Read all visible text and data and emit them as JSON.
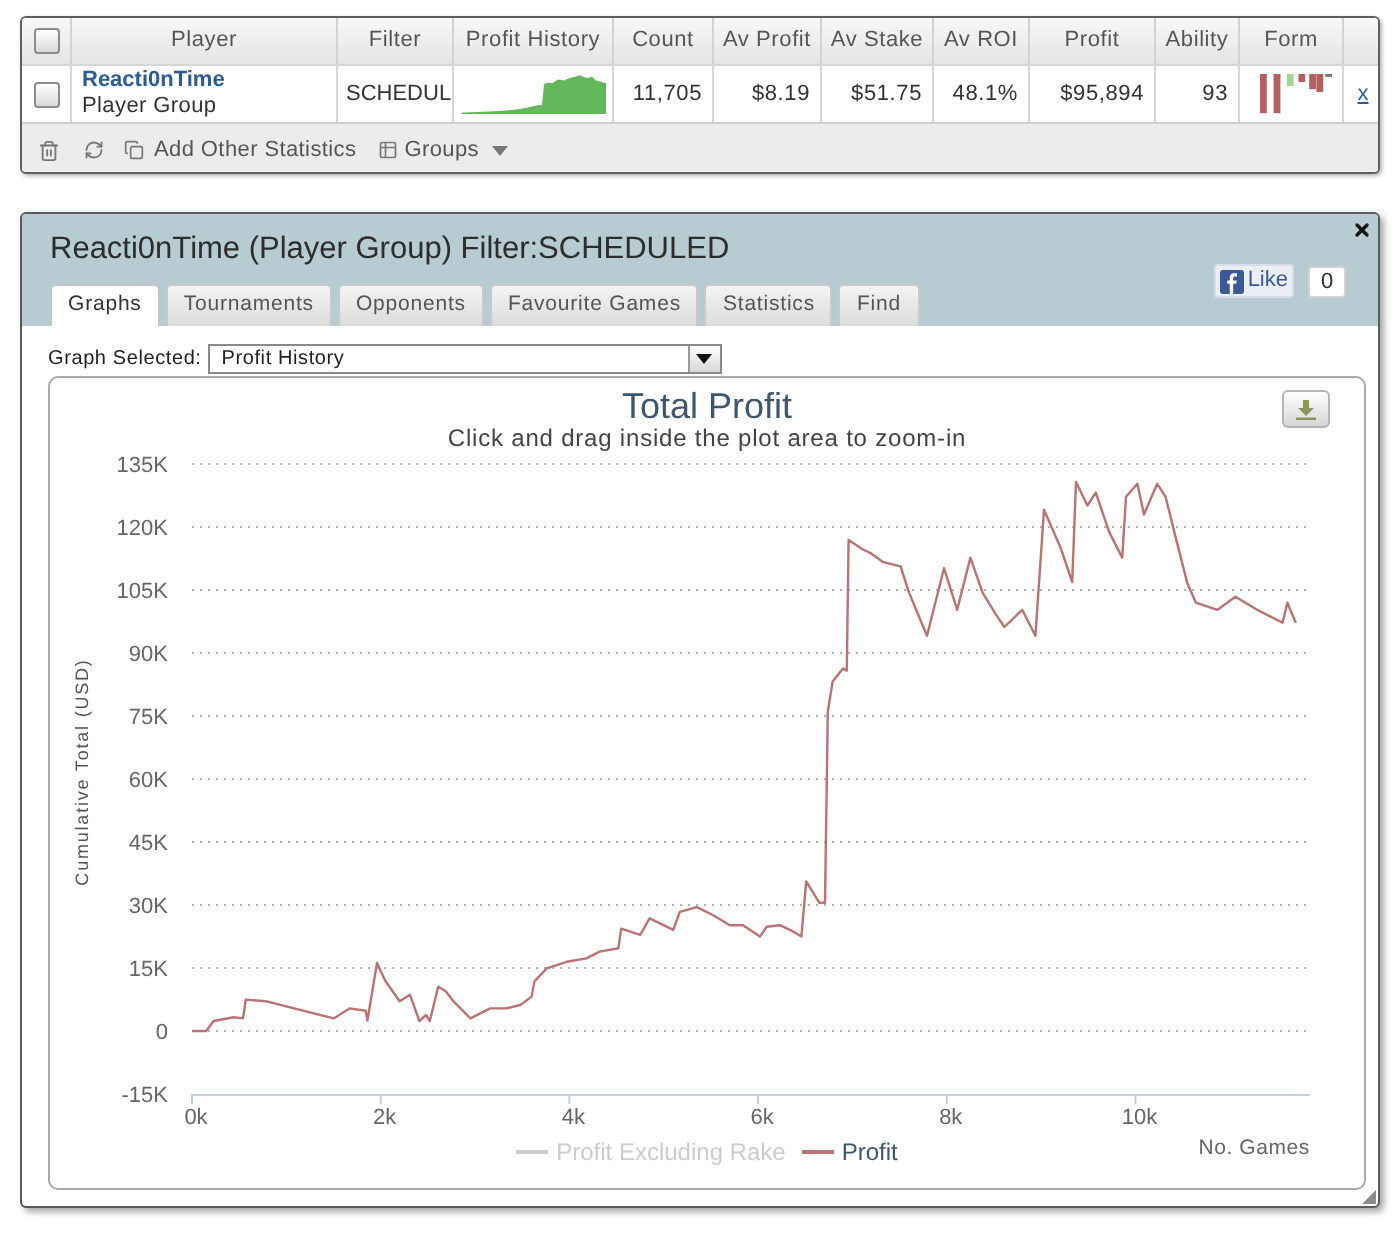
{
  "players_table": {
    "select_all": {
      "checked": false
    },
    "columns": [
      "Player",
      "Filter",
      "Profit History",
      "Count",
      "Av Profit",
      "Av Stake",
      "Av ROI",
      "Profit",
      "Ability",
      "Form"
    ],
    "rows": [
      {
        "checked": false,
        "player": "Reacti0nTime",
        "player_type": "Player Group",
        "filter": "SCHEDUL",
        "count": "11,705",
        "av_profit": "$8.19",
        "av_stake": "$51.75",
        "av_roi": "48.1%",
        "profit": "$95,894",
        "ability": "93",
        "remove": "x"
      }
    ],
    "toolbar": {
      "add_statistics": "Add Other Statistics",
      "groups": "Groups"
    }
  },
  "panel": {
    "title": "Reacti0nTime (Player Group) Filter:SCHEDULED",
    "like": {
      "label": "Like",
      "count": "0"
    },
    "tabs": [
      {
        "label": "Graphs",
        "selected": true
      },
      {
        "label": "Tournaments",
        "selected": false
      },
      {
        "label": "Opponents",
        "selected": false
      },
      {
        "label": "Favourite Games",
        "selected": false
      },
      {
        "label": "Statistics",
        "selected": false
      },
      {
        "label": "Find",
        "selected": false
      }
    ],
    "graph_selector": {
      "label": "Graph Selected:",
      "value": "Profit History"
    },
    "inactive_legend_items": [
      {
        "label": "Profit Excluding Rake",
        "enabled": false
      }
    ],
    "chart_data": {
      "type": "line",
      "title": "Total Profit",
      "subtitle": "Click and drag inside the plot area to zoom-in",
      "xlabel": "No. Games",
      "ylabel": "Cumulative Total (USD)",
      "grid": true,
      "x": [
        0,
        150,
        230,
        440,
        540,
        570,
        780,
        1500,
        1670,
        1840,
        1860,
        1960,
        2050,
        2200,
        2310,
        2410,
        2480,
        2520,
        2610,
        2690,
        2770,
        2950,
        3160,
        3330,
        3480,
        3600,
        3630,
        3760,
        3970,
        4180,
        4320,
        4520,
        4550,
        4750,
        4850,
        5100,
        5170,
        5350,
        5520,
        5700,
        5840,
        6020,
        6090,
        6230,
        6370,
        6460,
        6510,
        6650,
        6710,
        6740,
        6790,
        6900,
        6940,
        6960,
        7100,
        7190,
        7320,
        7510,
        7600,
        7790,
        7970,
        8110,
        8250,
        8380,
        8520,
        8610,
        8800,
        8940,
        9030,
        9210,
        9330,
        9370,
        9490,
        9580,
        9720,
        9860,
        9900,
        10020,
        10090,
        10230,
        10320,
        10410,
        10550,
        10640,
        10870,
        11060,
        11290,
        11560,
        11610,
        11700
      ],
      "series": [
        {
          "name": "Profit",
          "color": "#b97373",
          "values": [
            0,
            0,
            2400,
            3300,
            3000,
            7500,
            7100,
            3000,
            5400,
            4800,
            2500,
            16200,
            11900,
            7100,
            8600,
            2400,
            3800,
            2400,
            10500,
            9500,
            7100,
            3000,
            5400,
            5400,
            6200,
            8200,
            11800,
            14900,
            16500,
            17300,
            18900,
            19700,
            24400,
            22900,
            26800,
            24100,
            28400,
            29500,
            27600,
            25200,
            25200,
            22500,
            24800,
            25200,
            23700,
            22500,
            35600,
            30500,
            30500,
            76000,
            83200,
            86300,
            85800,
            116900,
            114800,
            113800,
            111700,
            110600,
            104400,
            94100,
            110200,
            100300,
            112700,
            104400,
            99200,
            96200,
            100300,
            94100,
            124100,
            114800,
            106900,
            130700,
            125100,
            128200,
            118900,
            112700,
            127200,
            130300,
            123000,
            130300,
            127200,
            118900,
            106500,
            102000,
            100300,
            103400,
            100300,
            97200,
            102000,
            97200
          ]
        }
      ],
      "xlim": [
        0,
        11850
      ],
      "ylim": [
        -15000,
        135000
      ],
      "xticks": [
        {
          "value": 0,
          "label": "0k"
        },
        {
          "value": 2000,
          "label": "2k"
        },
        {
          "value": 4000,
          "label": "4k"
        },
        {
          "value": 6000,
          "label": "6k"
        },
        {
          "value": 8000,
          "label": "8k"
        },
        {
          "value": 10000,
          "label": "10k"
        }
      ],
      "yticks": [
        {
          "value": -15000,
          "label": "-15K"
        },
        {
          "value": 0,
          "label": "0"
        },
        {
          "value": 15000,
          "label": "15K"
        },
        {
          "value": 30000,
          "label": "30K"
        },
        {
          "value": 45000,
          "label": "45K"
        },
        {
          "value": 60000,
          "label": "60K"
        },
        {
          "value": 75000,
          "label": "75K"
        },
        {
          "value": 90000,
          "label": "90K"
        },
        {
          "value": 105000,
          "label": "105K"
        },
        {
          "value": 120000,
          "label": "120K"
        },
        {
          "value": 135000,
          "label": "135K"
        }
      ]
    }
  }
}
